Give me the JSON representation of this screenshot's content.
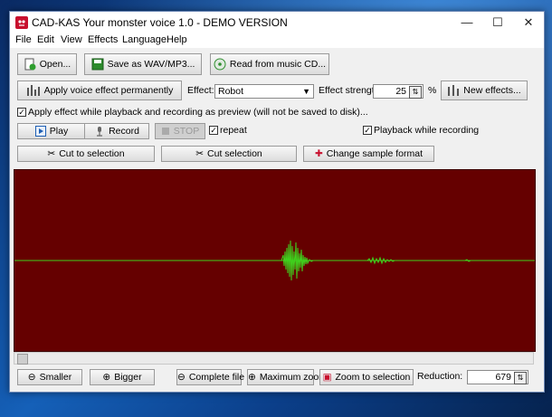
{
  "window": {
    "title": "CAD-KAS Your monster voice 1.0 - DEMO VERSION"
  },
  "menu": [
    "File",
    "Edit",
    "View",
    "Effects",
    "Language",
    "Help"
  ],
  "toolbar": {
    "open": "Open...",
    "save": "Save as WAV/MP3...",
    "read_cd": "Read from music CD...",
    "apply_effect": "Apply voice effect permanently",
    "effect_label": "Effect:",
    "effect_value": "Robot",
    "strength_label": "Effect strength:",
    "strength_value": "25",
    "percent": "%",
    "new_effects": "New effects...",
    "preview_check": "Apply effect while playback and recording as preview (will not be saved to disk)...",
    "play": "Play",
    "record": "Record",
    "stop": "STOP",
    "repeat": "repeat",
    "playback_while_recording": "Playback while recording",
    "cut_to_selection": "Cut to selection",
    "cut_selection": "Cut selection",
    "change_format": "Change sample format"
  },
  "bottom": {
    "smaller": "Smaller",
    "bigger": "Bigger",
    "complete_file": "Complete file",
    "maximum_zoom": "Maximum zoom",
    "zoom_to_selection": "Zoom to selection",
    "reduction_label": "Reduction:",
    "reduction_value": "679"
  },
  "colors": {
    "wave_bg": "#650000",
    "wave_line": "#3fd21d",
    "accent": "#1e5fb4"
  }
}
